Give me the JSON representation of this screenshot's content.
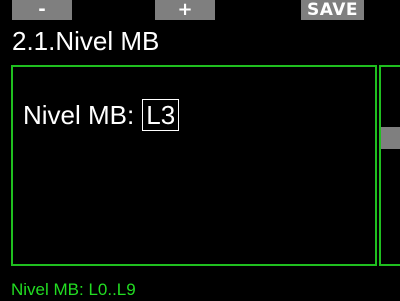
{
  "softkeys": {
    "left_label": "-",
    "middle_label": "+",
    "right_label": "SAVE"
  },
  "header": {
    "title": "2.1.Nivel MB"
  },
  "setting": {
    "label": "Nivel MB:",
    "value": "L3"
  },
  "footer": {
    "hint": "Nivel MB: L0..L9"
  },
  "colors": {
    "accent_green": "#1fbf1f",
    "softkey_gray": "#7f7f7f",
    "hint_green": "#22dd22"
  }
}
